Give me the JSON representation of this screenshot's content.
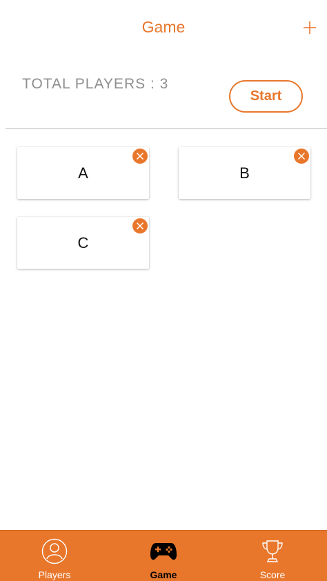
{
  "nav": {
    "title": "Game",
    "add_icon": "plus-icon"
  },
  "summary": {
    "total_players_label": "TOTAL PLAYERS : 3"
  },
  "actions": {
    "start_label": "Start"
  },
  "players": [
    {
      "name": "A",
      "remove_icon": "close-icon"
    },
    {
      "name": "B",
      "remove_icon": "close-icon"
    },
    {
      "name": "C",
      "remove_icon": "close-icon"
    }
  ],
  "tabs": [
    {
      "label": "Players",
      "icon": "person-circle-icon",
      "active": false
    },
    {
      "label": "Game",
      "icon": "gamepad-icon",
      "active": true
    },
    {
      "label": "Score",
      "icon": "trophy-icon",
      "active": false
    }
  ],
  "colors": {
    "accent": "#e8772c",
    "text_muted": "#8e8e8e",
    "tab_active": "#000000",
    "tab_inactive": "#ffffff"
  }
}
